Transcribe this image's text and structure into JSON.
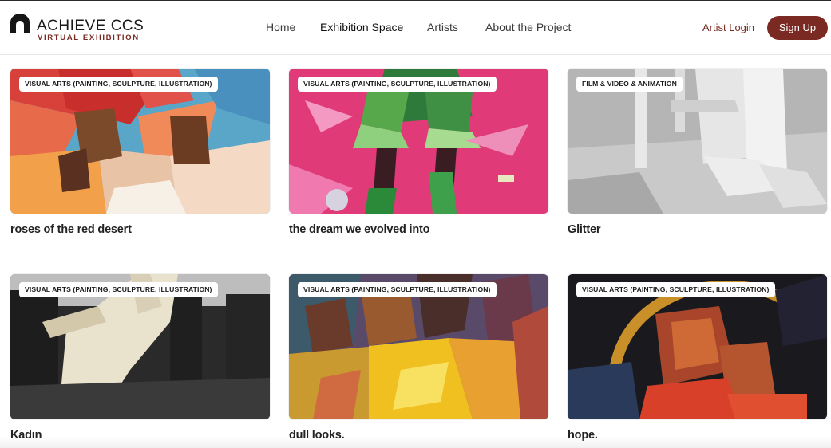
{
  "brand": {
    "name": "ACHIEVE CCS",
    "subtitle": "VIRTUAL EXHIBITION",
    "accent": "#7a2a22"
  },
  "nav": {
    "items": [
      {
        "label": "Home"
      },
      {
        "label": "Exhibition Space",
        "active": true
      },
      {
        "label": "Artists"
      },
      {
        "label": "About the Project"
      }
    ],
    "artist_login": "Artist Login",
    "sign_up": "Sign Up"
  },
  "artworks": [
    {
      "category": "VISUAL ARTS (PAINTING, SCULPTURE, ILLUSTRATION)",
      "title": "roses of the red desert"
    },
    {
      "category": "VISUAL ARTS (PAINTING, SCULPTURE, ILLUSTRATION)",
      "title": "the dream we evolved into"
    },
    {
      "category": "FILM & VIDEO & ANIMATION",
      "title": "Glitter"
    },
    {
      "category": "VISUAL ARTS (PAINTING, SCULPTURE, ILLUSTRATION)",
      "title": "Kadın"
    },
    {
      "category": "VISUAL ARTS (PAINTING, SCULPTURE, ILLUSTRATION)",
      "title": "dull looks."
    },
    {
      "category": "VISUAL ARTS (PAINTING, SCULPTURE, ILLUSTRATION)",
      "title": "hope."
    }
  ]
}
